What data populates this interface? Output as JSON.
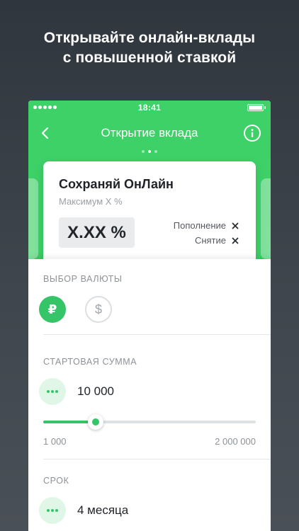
{
  "promo": {
    "line1": "Открывайте онлайн-вклады",
    "line2": "с повышенной ставкой"
  },
  "status_bar": {
    "time": "18:41",
    "battery_level": 1.0
  },
  "nav": {
    "title": "Открытие вклада",
    "back_icon": "chevron-left-icon",
    "info_icon": "info-icon"
  },
  "pager": {
    "count": 3,
    "active": 1
  },
  "deposit_card": {
    "title": "Сохраняй ОнЛайн",
    "subtitle": "Максимум X %",
    "rate": "X.XX %",
    "options": [
      {
        "label": "Пополнение",
        "icon": "cross-icon"
      },
      {
        "label": "Снятие",
        "icon": "cross-icon"
      }
    ]
  },
  "currency": {
    "label": "ВЫБОР ВАЛЮТЫ",
    "options": [
      {
        "symbol": "₽",
        "selected": true
      },
      {
        "symbol": "$",
        "selected": false
      }
    ]
  },
  "start_amount": {
    "label": "СТАРТОВАЯ СУММА",
    "value": "10 000",
    "min_label": "1 000",
    "max_label": "2 000 000",
    "slider_fraction": 0.245
  },
  "term": {
    "label": "СРОК",
    "value": "4 месяца"
  },
  "colors": {
    "accent": "#35c467",
    "header_green": "#3ed168"
  }
}
